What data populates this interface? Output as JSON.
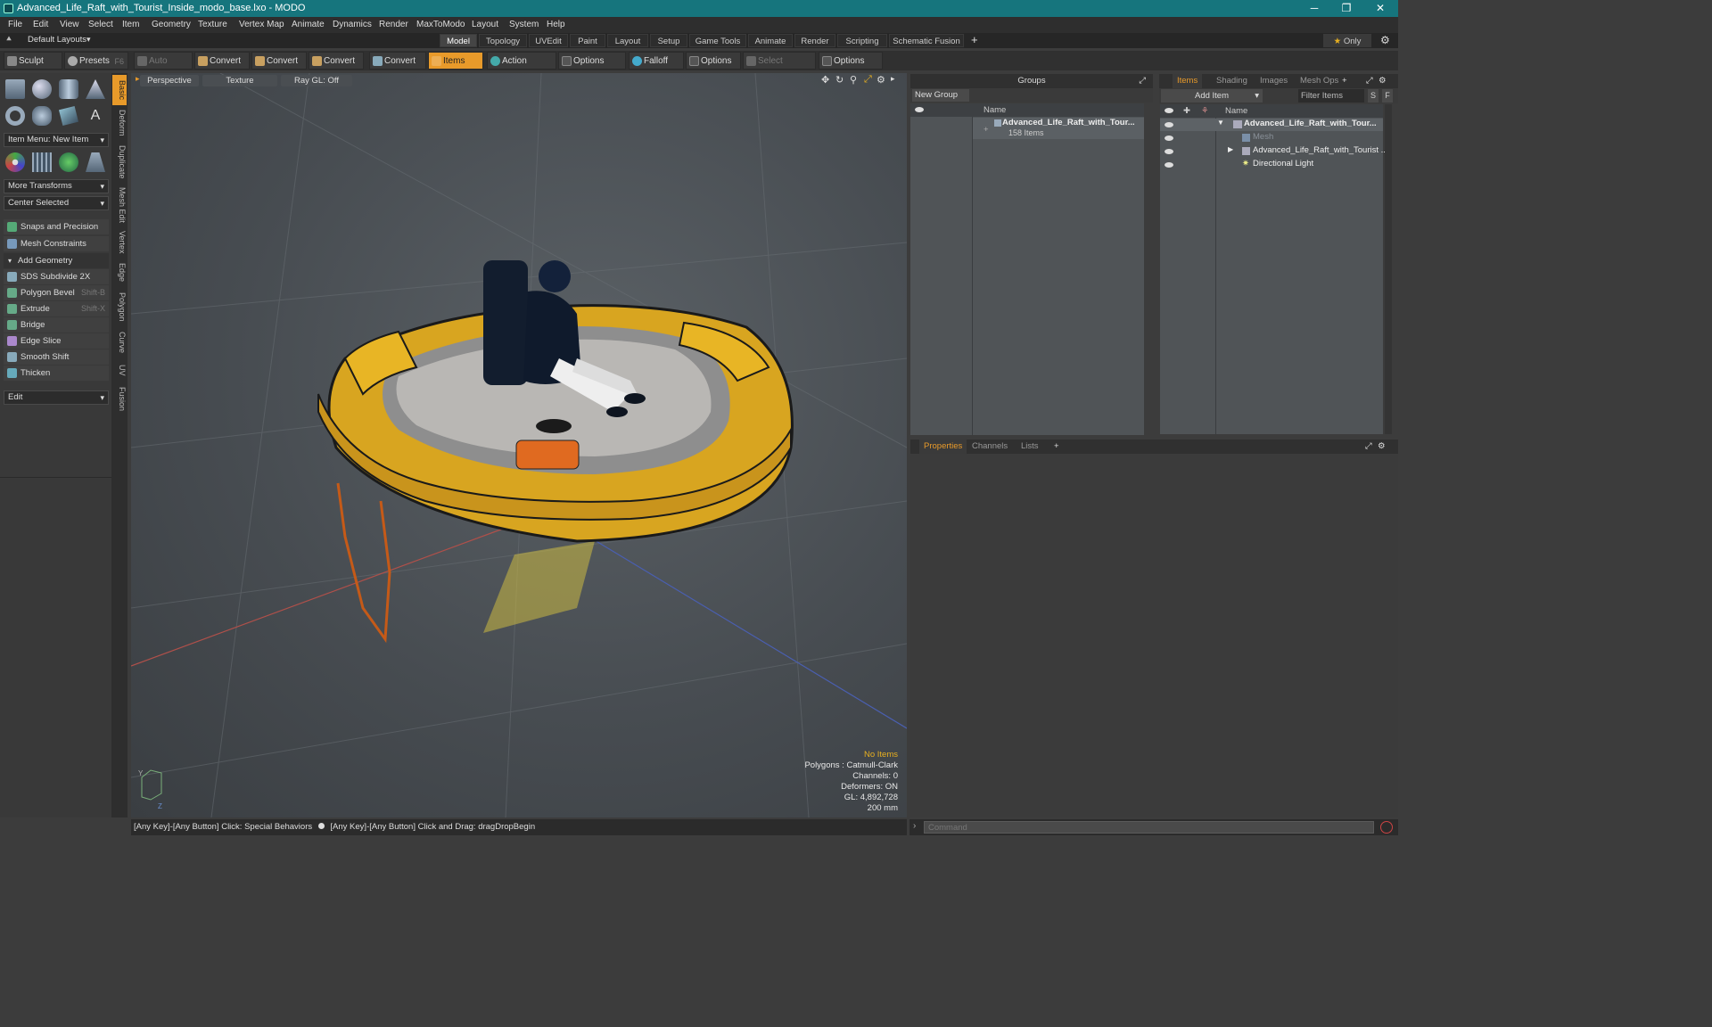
{
  "window": {
    "title": "Advanced_Life_Raft_with_Tourist_Inside_modo_base.lxo - MODO"
  },
  "menu": [
    "File",
    "Edit",
    "View",
    "Select",
    "Item",
    "Geometry",
    "Texture",
    "Vertex Map",
    "Animate",
    "Dynamics",
    "Render",
    "MaxToModo",
    "Layout",
    "System",
    "Help"
  ],
  "layout_selector": "Default Layouts",
  "tabs": [
    "Model",
    "Topology",
    "UVEdit",
    "Paint",
    "Layout",
    "Setup",
    "Game Tools",
    "Animate",
    "Render",
    "Scripting",
    "Schematic Fusion"
  ],
  "active_tab": "Model",
  "only_label": "Only",
  "toolbar": {
    "sculpt": "Sculpt",
    "presets": "Presets",
    "presets_key": "F6",
    "auto_select": "Auto Select",
    "convert1": "Convert",
    "convert2": "Convert",
    "convert3": "Convert",
    "convert4": "Convert",
    "items": "Items",
    "action_center": "Action Center",
    "options1": "Options",
    "falloff": "Falloff",
    "options2": "Options",
    "select_through": "Select Through",
    "options3": "Options"
  },
  "left": {
    "item_menu": "Item Menu: New Item",
    "more_transforms": "More Transforms",
    "center_selected": "Center Selected",
    "snaps": "Snaps and Precision",
    "mesh_constraints": "Mesh Constraints",
    "add_geometry": "Add Geometry",
    "tools": [
      {
        "label": "SDS Subdivide 2X",
        "key": ""
      },
      {
        "label": "Polygon Bevel",
        "key": "Shift-B"
      },
      {
        "label": "Extrude",
        "key": "Shift-X"
      },
      {
        "label": "Bridge",
        "key": ""
      },
      {
        "label": "Edge Slice",
        "key": ""
      },
      {
        "label": "Smooth Shift",
        "key": ""
      },
      {
        "label": "Thicken",
        "key": ""
      }
    ],
    "edit": "Edit"
  },
  "vtabs": [
    "Basic",
    "Deform",
    "Duplicate",
    "Mesh Edit",
    "Vertex",
    "Edge",
    "Polygon",
    "Curve",
    "UV",
    "Fusion"
  ],
  "viewport": {
    "perspective": "Perspective",
    "texture": "Texture",
    "raygl": "Ray GL: Off",
    "hud": {
      "no_items": "No Items",
      "polygons": "Polygons : Catmull-Clark",
      "channels": "Channels: 0",
      "deformers": "Deformers: ON",
      "gl": "GL: 4,892,728",
      "size": "200 mm"
    }
  },
  "status": {
    "left": "[Any Key]-[Any Button] Click: Special Behaviors",
    "right": "[Any Key]-[Any Button] Click and Drag: dragDropBegin"
  },
  "groups": {
    "title": "Groups",
    "new_group": "New Group",
    "col_name": "Name",
    "item_name": "Advanced_Life_Raft_with_Tour...",
    "item_count": "158 Items"
  },
  "items_panel": {
    "tabs": [
      "Items",
      "Shading",
      "Images",
      "Mesh Ops"
    ],
    "add_item": "Add Item",
    "filter": "Filter Items",
    "s": "S",
    "f": "F",
    "col_name": "Name",
    "rows": [
      "Advanced_Life_Raft_with_Tour...",
      "Mesh",
      "Advanced_Life_Raft_with_Tourist ...",
      "Directional Light"
    ]
  },
  "properties": {
    "tabs": [
      "Properties",
      "Channels",
      "Lists"
    ]
  },
  "command": {
    "placeholder": "Command"
  }
}
